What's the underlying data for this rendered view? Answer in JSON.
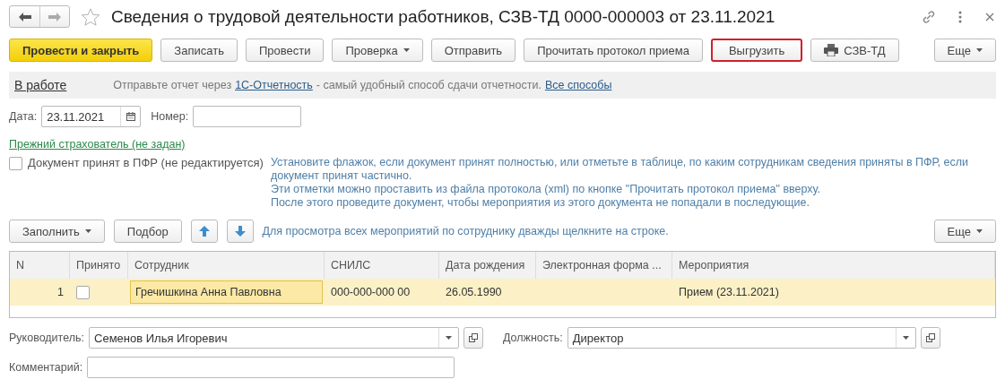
{
  "window": {
    "title": "Сведения о трудовой деятельности работников, СЗВ-ТД 0000-000003 от 23.11.2021",
    "favorite": false
  },
  "toolbar": [
    {
      "label": "Провести и закрыть",
      "kind": "primary",
      "highlighted": false
    },
    {
      "label": "Записать",
      "kind": "plain",
      "highlighted": false
    },
    {
      "label": "Провести",
      "kind": "plain",
      "highlighted": false
    },
    {
      "label": "Проверка",
      "kind": "dropdown",
      "highlighted": false
    },
    {
      "label": "Отправить",
      "kind": "plain",
      "highlighted": false
    },
    {
      "label": "Прочитать протокол приема",
      "kind": "plain",
      "highlighted": false
    },
    {
      "label": "Выгрузить",
      "kind": "plain",
      "highlighted": true
    },
    {
      "label": "СЗВ-ТД",
      "kind": "print",
      "highlighted": false
    }
  ],
  "toolbar_more": "Еще",
  "status_bar": {
    "status": "В работе",
    "text_before": "Отправьте отчет через",
    "link": "1С-Отчетность",
    "text_after": "- самый удобный способ сдачи отчетности.",
    "link_2": "Все способы"
  },
  "date": {
    "label": "Дата:",
    "value": "23.11.2021"
  },
  "number": {
    "label": "Номер:"
  },
  "previous_insurer_link": "Прежний страхователь (не задан)",
  "accepted_checkbox": {
    "label": "Документ принят в ПФР (не редактируется)",
    "checked": false
  },
  "hint_lines": [
    "Установите флажок, если документ принят полностью, или отметьте в таблице, по каким сотрудникам сведения приняты в ПФР, если",
    "документ принят частично.",
    "Эти отметки можно проставить из файла протокола (xml) по кнопке \"Прочитать протокол приема\" вверху.",
    "После этого проведите документ, чтобы мероприятия из этого документа не попадали в последующие."
  ],
  "table_toolbar": {
    "fill": "Заполнить",
    "pick": "Подбор",
    "hint": "Для просмотра всех мероприятий по сотруднику дважды щелкните на строке.",
    "more": "Еще"
  },
  "table": {
    "columns": [
      "N",
      "Принято",
      "Сотрудник",
      "СНИЛС",
      "Дата рождения",
      "Электронная форма ...",
      "Мероприятия"
    ],
    "rows": [
      {
        "n": "1",
        "accepted": false,
        "employee": "Гречишкина Анна Павловна",
        "snils": "000-000-000 00",
        "birth_date": "26.05.1990",
        "events": "Прием (23.11.2021)",
        "selected": true
      }
    ]
  },
  "manager": {
    "label": "Руководитель:",
    "value": "Семенов Илья Игоревич"
  },
  "position": {
    "label": "Должность:",
    "value": "Директор"
  },
  "comment": {
    "label": "Комментарий:"
  }
}
